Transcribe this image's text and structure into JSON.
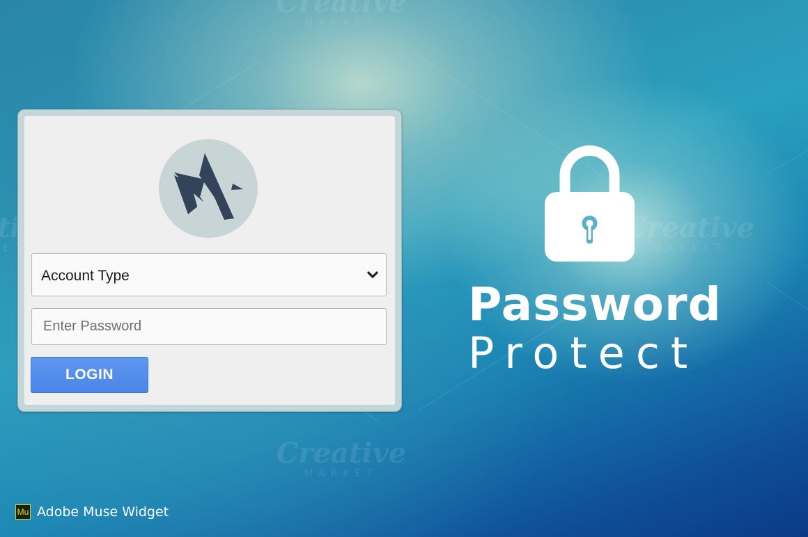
{
  "background": {
    "watermark_line1": "Creative",
    "watermark_line2": "MARKET"
  },
  "login_panel": {
    "logo_icon": "stylized-arrow-logo",
    "logo_color": "#33435a",
    "account_type": {
      "selected_label": "Account Type",
      "chevron_icon": "chevron-down-icon"
    },
    "password": {
      "placeholder": "Enter Password",
      "value": ""
    },
    "login_button": {
      "label": "LOGIN",
      "color": "#4a86ea"
    }
  },
  "hero": {
    "lock_icon": "padlock-icon",
    "title_line1": "Password",
    "title_line2": "Protect"
  },
  "footer": {
    "badge_icon": "Mu",
    "badge_text": "Adobe Muse Widget"
  }
}
